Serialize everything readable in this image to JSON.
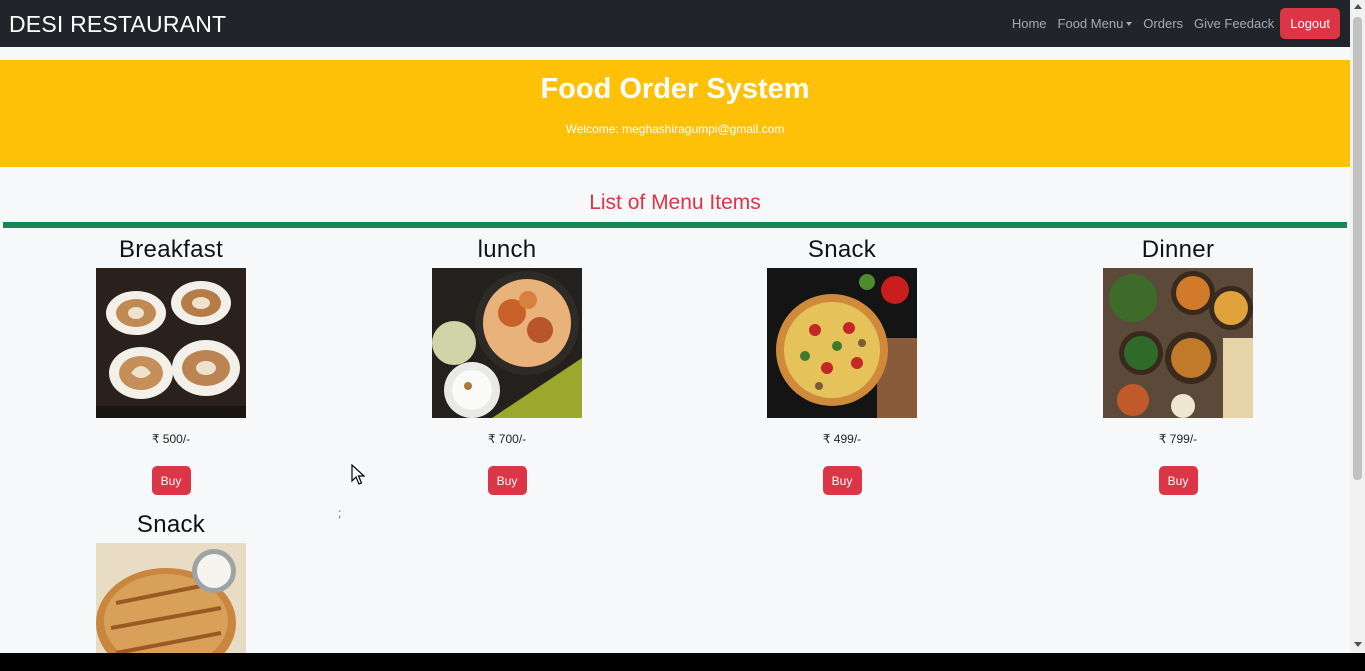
{
  "navbar": {
    "brand": "DESI RESTAURANT",
    "links": [
      "Home",
      "Food Menu",
      "Orders",
      "Give Feedack"
    ],
    "logout": "Logout"
  },
  "hero": {
    "title": "Food Order System",
    "welcome": "Welcome: meghashiragumpi@gmail.com"
  },
  "section": {
    "title": "List of Menu Items"
  },
  "menu_items": [
    {
      "name": "Breakfast",
      "price": "₹ 500/-",
      "buy": "Buy",
      "image_icon": "coffee-cups-image"
    },
    {
      "name": "lunch",
      "price": "₹ 700/-",
      "buy": "Buy",
      "image_icon": "biryani-image"
    },
    {
      "name": "Snack",
      "price": "₹ 499/-",
      "buy": "Buy",
      "image_icon": "pizza-image"
    },
    {
      "name": "Dinner",
      "price": "₹ 799/-",
      "buy": "Buy",
      "image_icon": "thali-image"
    },
    {
      "name": "Snack",
      "price": "",
      "buy": "",
      "image_icon": "garlic-bread-image"
    }
  ],
  "stray_text": ";",
  "colors": {
    "navbar": "#212529",
    "hero": "#ffc107",
    "accent_red": "#dc3545",
    "rule_green": "#198754",
    "background": "#f7f8fa"
  }
}
